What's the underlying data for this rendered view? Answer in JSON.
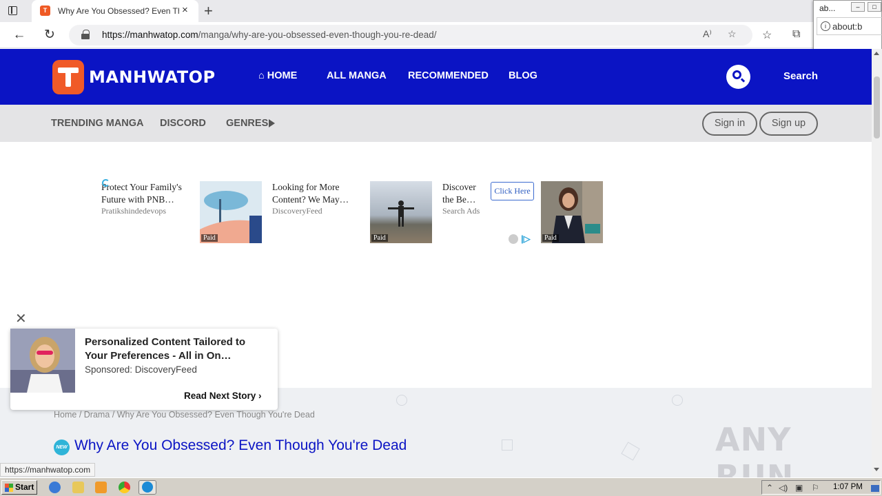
{
  "browser": {
    "tab_title": "Why Are You Obsessed? Even Though You're Dead",
    "tab_close": "×",
    "new_tab": "+",
    "url_host": "https://manhwatop.com",
    "url_path": "/manga/why-are-you-obsessed-even-though-you-re-dead/",
    "read_aloud": "A⁾",
    "status_url": "https://manhwatop.com"
  },
  "popup": {
    "title": "ab...",
    "url": "about:b"
  },
  "site": {
    "logo_text": "MANHWATOP",
    "nav": [
      "HOME",
      "ALL MANGA",
      "RECOMMENDED",
      "BLOG"
    ],
    "search_label": "Search",
    "subnav": [
      "TRENDING MANGA",
      "DISCORD",
      "GENRES"
    ],
    "sign_in": "Sign in",
    "sign_up": "Sign up"
  },
  "ads": [
    {
      "title": "Protect Your Family's Future with PNB…",
      "source": "Pratikshindedevops"
    },
    {
      "title": "Looking for More Content? We May…",
      "source": "DiscoveryFeed"
    },
    {
      "title": "Discover the Be…",
      "source": "Search Ads"
    }
  ],
  "ad_paid_label": "Paid",
  "ad_click_here": "Click Here",
  "sticky_ad": {
    "close": "✕",
    "headline": "Personalized Content Tailored to Your Preferences - All in On…",
    "sponsor": "Sponsored: DiscoveryFeed",
    "read_next": "Read Next Story ›"
  },
  "breadcrumb": {
    "home": "Home",
    "category": "Drama",
    "current": "Why Are You Obsessed? Even Though You're Dead"
  },
  "page_title": "Why Are You Obsessed? Even Though You're Dead",
  "new_badge": "NEW",
  "watermark": "ANY RUN",
  "taskbar": {
    "start": "Start",
    "clock": "1:07 PM"
  },
  "colors": {
    "header_blue": "#0b14c4",
    "logo_orange": "#f05a28"
  }
}
